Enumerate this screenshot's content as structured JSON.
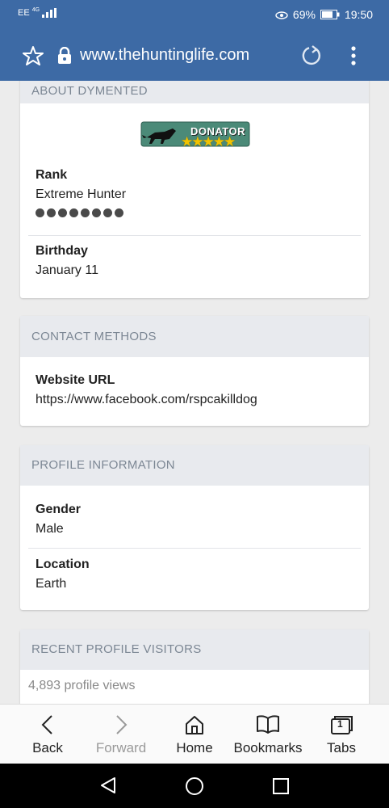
{
  "status_bar": {
    "carrier": "EE",
    "network": "4G",
    "battery": "69%",
    "time": "19:50"
  },
  "browser": {
    "url": "www.thehuntinglife.com"
  },
  "about": {
    "heading": "ABOUT DYMENTED",
    "badge_text": "DONATOR",
    "rank_label": "Rank",
    "rank_value": "Extreme Hunter",
    "rank_dots": 8,
    "birthday_label": "Birthday",
    "birthday_value": "January 11"
  },
  "contact": {
    "heading": "CONTACT METHODS",
    "website_label": "Website URL",
    "website_value": "https://www.facebook.com/rspcakilldog"
  },
  "profile": {
    "heading": "PROFILE INFORMATION",
    "gender_label": "Gender",
    "gender_value": "Male",
    "location_label": "Location",
    "location_value": "Earth"
  },
  "visitors": {
    "heading": "RECENT PROFILE VISITORS",
    "views": "4,893 profile views"
  },
  "nav": {
    "back": "Back",
    "forward": "Forward",
    "home": "Home",
    "bookmarks": "Bookmarks",
    "tabs": "Tabs",
    "tab_count": "1"
  },
  "colors": {
    "toolbar": "#3d6aa5",
    "section_header": "#e8eaee",
    "badge_green": "#4b8a78",
    "star_yellow": "#f2c300"
  }
}
